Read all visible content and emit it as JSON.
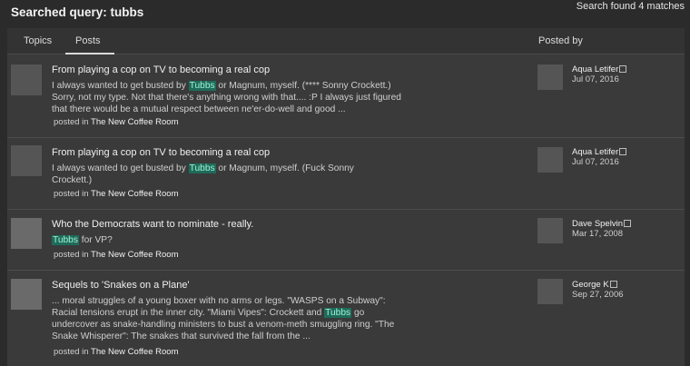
{
  "header": {
    "title_prefix": "Searched query: ",
    "query": "tubbs",
    "found": "Search found 4 matches"
  },
  "tabs": [
    {
      "label": "Topics",
      "active": false
    },
    {
      "label": "Posts",
      "active": true
    }
  ],
  "columns": {
    "posted_by": "Posted by"
  },
  "posts": [
    {
      "title": "From playing a cop on TV to becoming a real cop",
      "excerpt_before": "I always wanted to get busted by ",
      "highlight": "Tubbs",
      "excerpt_after": " or Magnum, myself. (**** Sonny Crockett.) Sorry, not my type. Not that there's anything wrong with that.... :P I always just figured that there would be a mutual respect between ne'er-do-well and good ...",
      "posted_in_label": "posted in",
      "room": "The New Coffee Room",
      "author": "Aqua Letifer",
      "date": "Jul 07, 2016",
      "avatar": "sketch-avatar"
    },
    {
      "title": "From playing a cop on TV to becoming a real cop",
      "excerpt_before": "I always wanted to get busted by ",
      "highlight": "Tubbs",
      "excerpt_after": " or Magnum, myself. (Fuck Sonny Crockett.)",
      "posted_in_label": "posted in",
      "room": "The New Coffee Room",
      "author": "Aqua Letifer",
      "date": "Jul 07, 2016",
      "avatar": "sketch-avatar"
    },
    {
      "title": "Who the Democrats want to nominate - really.",
      "excerpt_before": "",
      "highlight": "Tubbs",
      "excerpt_after": " for VP?",
      "posted_in_label": "posted in",
      "room": "The New Coffee Room",
      "author": "Dave Spelvin",
      "date": "Mar 17, 2008",
      "avatar": "photo-avatar"
    },
    {
      "title": "Sequels to 'Snakes on a Plane'",
      "excerpt_before": "... moral struggles of a young boxer with no arms or legs. \"WASPS on a Subway\": Racial tensions erupt in the inner city. \"Miami Vipes\": Crockett and ",
      "highlight": "Tubbs",
      "excerpt_after": " go undercover as snake-handling ministers to bust a venom-meth smuggling ring. \"The Snake Whisperer\": The snakes that survived the fall from the ...",
      "posted_in_label": "posted in",
      "room": "The New Coffee Room",
      "author": "George K",
      "date": "Sep 27, 2006",
      "avatar": "photo-avatar"
    }
  ]
}
